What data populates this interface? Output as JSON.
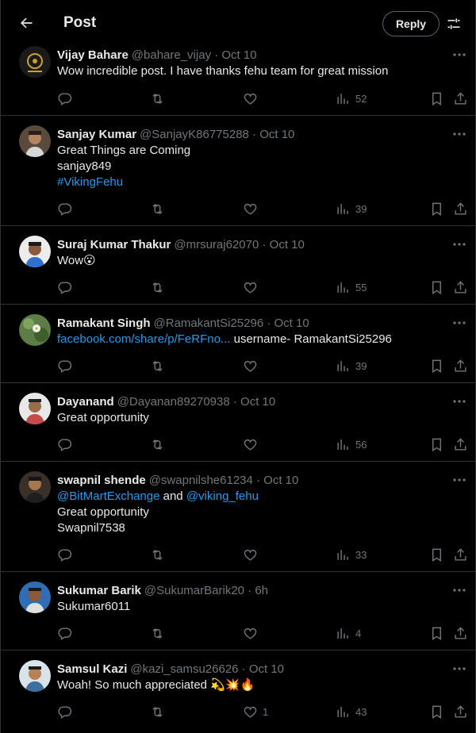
{
  "header": {
    "title": "Post",
    "reply_label": "Reply"
  },
  "tweets": [
    {
      "name": "Vijay Bahare",
      "handle": "@bahare_vijay · Oct 10",
      "text": [
        "Wow incredible post. I have thanks fehu team for great mission"
      ],
      "views": "52",
      "likes": "",
      "avatar_color": "#222"
    },
    {
      "name": "Sanjay Kumar",
      "handle": "@SanjayK86775288 · Oct 10",
      "text": [
        "Great Things are Coming",
        "sanjay849",
        "#VikingFehu"
      ],
      "views": "39",
      "likes": ""
    },
    {
      "name": "Suraj Kumar Thakur",
      "handle": "@mrsuraj62070 · Oct 10",
      "text": [
        "Wow😮"
      ],
      "views": "55",
      "likes": ""
    },
    {
      "name": "Ramakant Singh",
      "handle": "@RamakantSi25296 · Oct 10",
      "text_link": "facebook.com/share/p/FeRFno...",
      "text_rest": " username- RamakantSi25296",
      "views": "39",
      "likes": ""
    },
    {
      "name": "Dayanand",
      "handle": "@Dayanan89270938 · Oct 10",
      "text": [
        "Great opportunity"
      ],
      "views": "56",
      "likes": ""
    },
    {
      "name": "swapnil shende",
      "handle": "@swapnilshe61234 · Oct 10",
      "mention1": "@BitMartExchange",
      "and": " and ",
      "mention2": "@viking_fehu",
      "text": [
        "Great opportunity",
        "Swapnil7538"
      ],
      "views": "33",
      "likes": ""
    },
    {
      "name": "Sukumar Barik",
      "handle": "@SukumarBarik20 · 6h",
      "text": [
        "Sukumar6011"
      ],
      "views": "4",
      "likes": ""
    },
    {
      "name": "Samsul Kazi",
      "handle": "@kazi_samsu26626 · Oct 10",
      "text": [
        "Woah! So much appreciated 💫💥🔥"
      ],
      "views": "43",
      "likes": "1"
    }
  ],
  "icons": {
    "back": "arrow-left-icon",
    "settings": "sliders-icon",
    "more": "more-icon",
    "reply": "reply-icon",
    "repost": "repost-icon",
    "like": "heart-icon",
    "views": "views-icon",
    "bookmark": "bookmark-icon",
    "share": "share-icon"
  },
  "colors": {
    "background": "#000000",
    "text": "#e7e9ea",
    "secondary": "#71767b",
    "link": "#1d9bf0",
    "border": "#2f3336"
  }
}
